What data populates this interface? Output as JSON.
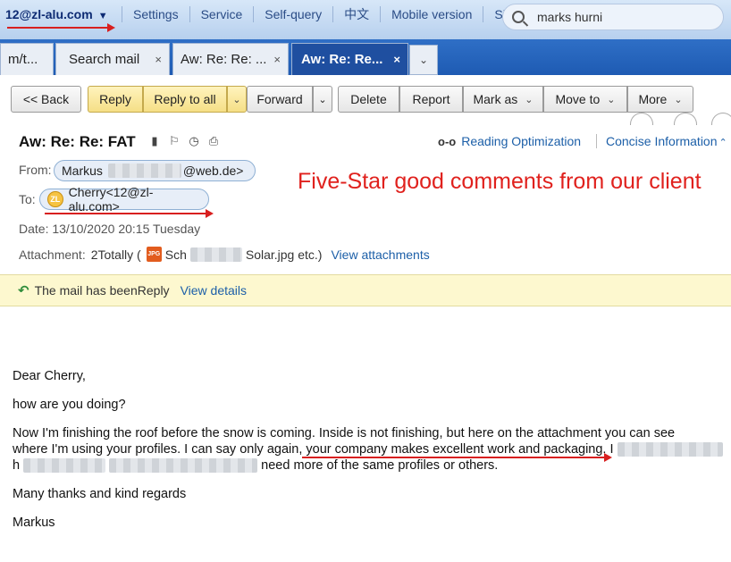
{
  "topbar": {
    "account": "12@zl-alu.com",
    "links": [
      "Settings",
      "Service",
      "Self-query",
      "中文",
      "Mobile version",
      "Sign out"
    ],
    "search_value": "marks hurni"
  },
  "tabs": [
    {
      "label": "m/t...",
      "active": false
    },
    {
      "label": "Search mail",
      "active": false,
      "close": "×"
    },
    {
      "label": "Aw: Re: Re: ...",
      "active": false,
      "close": "×"
    },
    {
      "label": "Aw: Re: Re...",
      "active": true,
      "close": "×"
    }
  ],
  "toolbar": {
    "back": "<< Back",
    "reply": "Reply",
    "reply_all": "Reply to all",
    "forward": "Forward",
    "delete": "Delete",
    "report": "Report",
    "mark_as": "Mark as",
    "move_to": "Move to",
    "more": "More"
  },
  "mail": {
    "subject": "Aw: Re: Re: FAT",
    "reading_opt": "Reading Optimization",
    "concise": "Concise Information",
    "from_label": "From:",
    "from_name": "Markus",
    "from_domain": "@web.de>",
    "to_label": "To:",
    "to_value": "Cherry<12@zl-alu.com>",
    "date_label": "Date:",
    "date_value": "13/10/2020 20:15 Tuesday",
    "attachment_label": "Attachment:",
    "attachment_count": "2Totally (",
    "attachment_prefix": "Sch",
    "attachment_suffix": "Solar.jpg etc.)",
    "view_attachments": "View attachments",
    "reply_notice": "The mail has beenReply",
    "view_details": "View details"
  },
  "annotation": "Five-Star good comments from our client",
  "body": {
    "greeting": "Dear Cherry,",
    "line1": "how are you doing?",
    "para_a": "Now I'm finishing the roof before the snow is coming. Inside is not finishing, but here on the attachment you can see",
    "para_b": "where I'm using your profiles. I can say only again, your company makes excellent work and packaging. I",
    "para_c_prefix": "h",
    "para_c": "need more of the same profiles or others.",
    "thanks": "Many thanks and kind regards",
    "signature": "Markus"
  },
  "colors": {
    "tabbar": "#1e5bb3",
    "annotation": "#e0211d",
    "link": "#1c5fa8",
    "reply_button": "#f5df86"
  }
}
